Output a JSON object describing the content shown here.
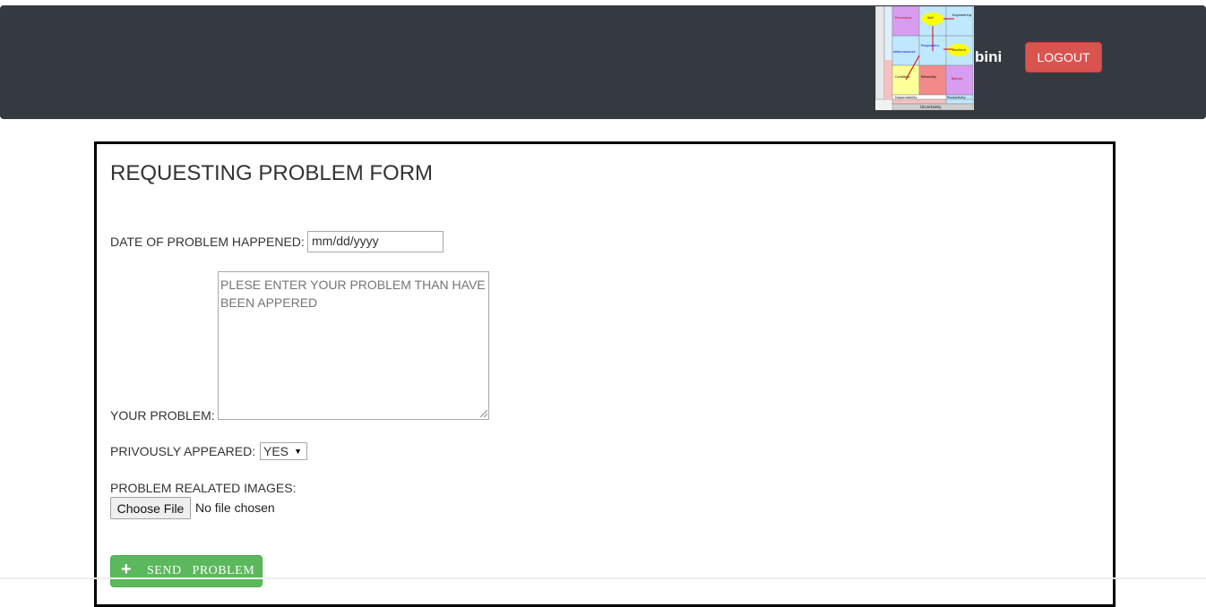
{
  "navbar": {
    "user_name": "bini",
    "logout_label": "LOGOUT",
    "logo_texts": {
      "preventive": "Preventive Maintenance",
      "self": "Self-Maintenance",
      "engineering": "Engineering Immune Systems",
      "prognostics": "Prognostics & Health Management",
      "emaintenance": "eMaintenance",
      "resilient": "Resilient Systems",
      "condition": "Condition Based Maintenance",
      "reliability": "Reliability Centered Maintenance",
      "robust": "Robust Design",
      "dependability": "Dependability",
      "productivity": "Productivity",
      "uncertainty": "Uncertainty",
      "complexity": "Complexity"
    }
  },
  "form": {
    "title": "REQUESTING PROBLEM FORM",
    "date_label": "DATE OF PROBLEM HAPPENED:",
    "date_placeholder": "mm/dd/yyyy",
    "problem_label": "YOUR PROBLEM:",
    "problem_placeholder": "PLESE ENTER YOUR PROBLEM THAN HAVE BEEN APPERED",
    "previously_label": "PRIVOUSLY APPEARED:",
    "previously_value": "YES",
    "images_label": "PROBLEM REALATED IMAGES:",
    "choose_file_label": "Choose File",
    "file_status": "No file chosen",
    "send_icon": "plus-icon",
    "send_label": "SEND PROBLEM"
  },
  "colors": {
    "navbar": "#343a40",
    "logout": "#d9534f",
    "send": "#5cb85c"
  }
}
